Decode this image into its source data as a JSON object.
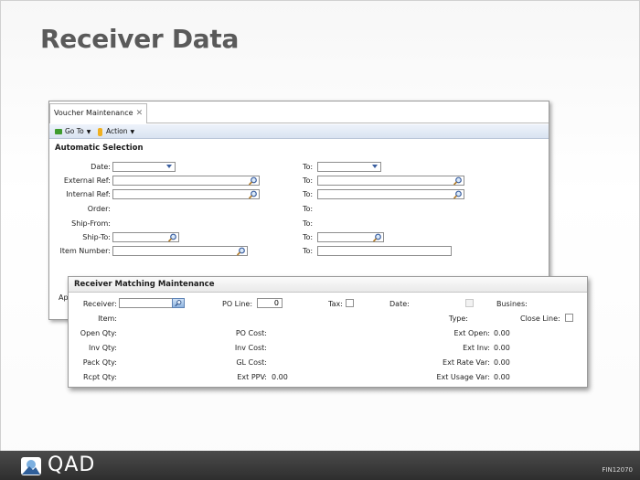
{
  "slide": {
    "title": "Receiver Data",
    "brand": "QAD",
    "code": "FIN12070"
  },
  "voucher_window": {
    "tab_label": "Voucher Maintenance",
    "toolbar": {
      "goto_label": "Go To",
      "action_label": "Action"
    },
    "section_title": "Automatic Selection",
    "fields": {
      "date": "Date:",
      "external_ref": "External Ref:",
      "internal_ref": "Internal Ref:",
      "order": "Order:",
      "ship_from": "Ship-From:",
      "ship_to": "Ship-To:",
      "item_number": "Item Number:",
      "to": "To:"
    },
    "hidden_label_fragment": "Ap"
  },
  "receiver_window": {
    "title": "Receiver Matching Maintenance",
    "labels": {
      "receiver": "Receiver:",
      "po_line": "PO Line:",
      "tax": "Tax:",
      "date": "Date:",
      "business": "Busines:",
      "item": "Item:",
      "type": "Type:",
      "close_line": "Close Line:",
      "open_qty": "Open Qty:",
      "po_cost": "PO Cost:",
      "ext_open": "Ext Open:",
      "inv_qty": "Inv Qty:",
      "inv_cost": "Inv Cost:",
      "ext_inv": "Ext Inv:",
      "pack_qty": "Pack Qty:",
      "gl_cost": "GL Cost:",
      "ext_rate_var": "Ext Rate Var:",
      "rcpt_qty": "Rcpt Qty:",
      "ext_ppv": "Ext PPV:",
      "ext_usage_var": "Ext Usage Var:"
    },
    "values": {
      "po_line": "0",
      "ext_open": "0.00",
      "ext_inv": "0.00",
      "ext_rate_var": "0.00",
      "ext_ppv": "0.00",
      "ext_usage_var": "0.00"
    }
  },
  "icons": {
    "lookup": "magnifier-icon",
    "dropdown": "chevron-down-icon",
    "goto": "arrow-icon",
    "action": "hand-icon",
    "close_tab": "close-icon"
  },
  "colors": {
    "title_text": "#5a5a5a",
    "footer_bg": "#333333",
    "toolbar_bg": "#dfe7f3",
    "accent_blue": "#3b5fa0"
  }
}
